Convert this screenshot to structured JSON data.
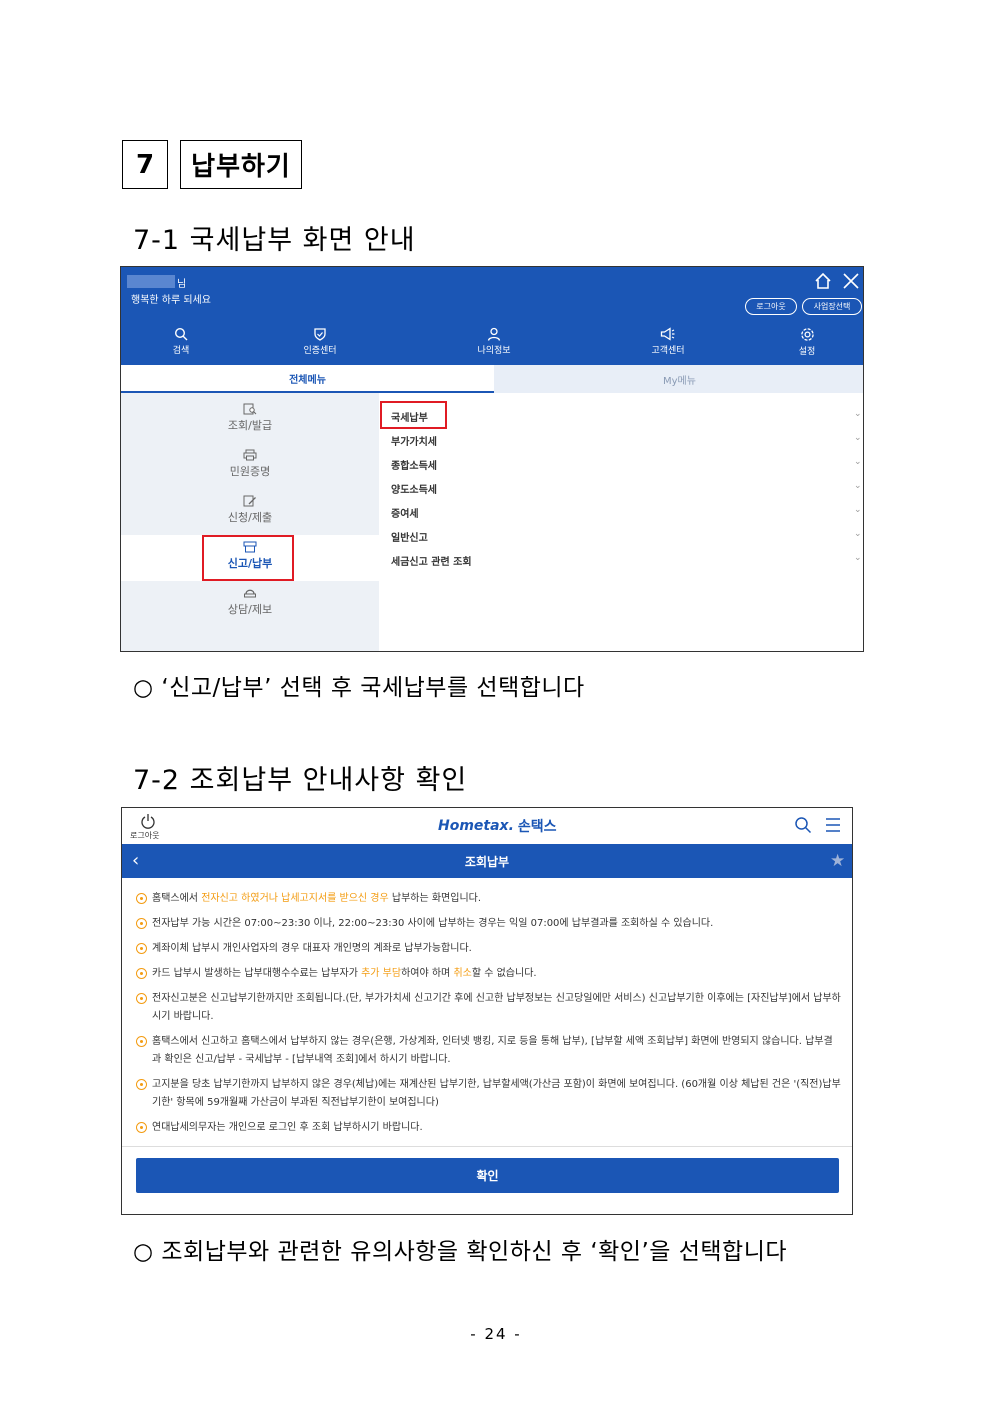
{
  "section": {
    "number": "7",
    "title": "납부하기"
  },
  "s71": {
    "heading": "7-1 국세납부 화면 안내",
    "bullet": "○ ‘신고/납부’ 선택 후 국세납부를 선택합니다",
    "screen": {
      "suffix": "님",
      "greeting": "행복한 하루 되세요",
      "logout_label": "로그아웃",
      "biz_select_label": "사업장선택",
      "nav": [
        {
          "label": "검색",
          "icon": "search-icon"
        },
        {
          "label": "인증센터",
          "icon": "shield-icon"
        },
        {
          "label": "나의정보",
          "icon": "user-icon"
        },
        {
          "label": "고객센터",
          "icon": "megaphone-icon"
        },
        {
          "label": "설정",
          "icon": "gear-icon"
        }
      ],
      "tabs": {
        "all": "전체메뉴",
        "my": "My메뉴"
      },
      "categories": [
        "조회/발급",
        "민원증명",
        "신청/제출",
        "신고/납부",
        "상담/제보"
      ],
      "selected_category": "신고/납부",
      "items": [
        "국세납부",
        "부가가치세",
        "종합소득세",
        "양도소득세",
        "증여세",
        "일반신고",
        "세금신고 관련 조회"
      ],
      "highlighted_item": "국세납부"
    }
  },
  "s72": {
    "heading": "7-2 조회납부 안내사항 확인",
    "bullet": "○ 조회납부와 관련한 유의사항을 확인하신 후 ‘확인’을 선택합니다",
    "screen": {
      "logout_label": "로그아웃",
      "logo_en": "Hometax.",
      "logo_kr": "손택스",
      "title": "조회납부",
      "notes": [
        {
          "parts": [
            {
              "t": "홈택스에서 ",
              "hl": false
            },
            {
              "t": "전자신고 하였거나 납세고지서를 받으신 경우",
              "hl": true
            },
            {
              "t": " 납부하는 화면입니다.",
              "hl": false
            }
          ]
        },
        {
          "parts": [
            {
              "t": "전자납부 가능 시간은 07:00~23:30 이나, 22:00~23:30 사이에 납부하는 경우는 익일 07:00에 납부결과를 조회하실 수 있습니다.",
              "hl": false
            }
          ]
        },
        {
          "parts": [
            {
              "t": "계좌이체 납부시 개인사업자의 경우 대표자 개인명의 계좌로 납부가능합니다.",
              "hl": false
            }
          ]
        },
        {
          "parts": [
            {
              "t": "카드 납부시 발생하는 납부대행수수료는 납부자가 ",
              "hl": false
            },
            {
              "t": "추가 부담",
              "hl": true
            },
            {
              "t": "하여야 하며 ",
              "hl": false
            },
            {
              "t": "취소",
              "hl": true
            },
            {
              "t": "할 수 없습니다.",
              "hl": false
            }
          ]
        },
        {
          "parts": [
            {
              "t": "전자신고분은 신고납부기한까지만 조회됩니다.(단, 부가가치세 신고기간 후에 신고한 납부정보는 신고당일에만 서비스) 신고납부기한 이후에는 [자진납부]에서 납부하시기 바랍니다.",
              "hl": false
            }
          ]
        },
        {
          "parts": [
            {
              "t": "홈택스에서 신고하고 홈택스에서 납부하지 않는 경우(은행, 가상계좌, 인터넷 뱅킹, 지로 등을 통해 납부), [납부할 세액 조회납부] 화면에 반영되지 않습니다. 납부결과 확인은 신고/납부 - 국세납부 - [납부내역 조회]에서 하시기 바랍니다.",
              "hl": false
            }
          ]
        },
        {
          "parts": [
            {
              "t": "고지분을 당초 납부기한까지 납부하지 않은 경우(체납)에는 재계산된 납부기한, 납부할세액(가산금 포함)이 화면에 보여집니다. (60개월 이상 체납된 건은 '(직전)납부기한' 항목에 59개월째 가산금이 부과된 직전납부기한이 보여집니다)",
              "hl": false
            }
          ]
        },
        {
          "parts": [
            {
              "t": "연대납세의무자는 개인으로 로그인 후 조회 납부하시기 바랍니다.",
              "hl": false
            }
          ]
        }
      ],
      "confirm_label": "확인"
    }
  },
  "page_number": "- 24 -",
  "colors": {
    "primary": "#1b56b5",
    "highlight": "#f39c12",
    "red_box": "#e01b24"
  }
}
